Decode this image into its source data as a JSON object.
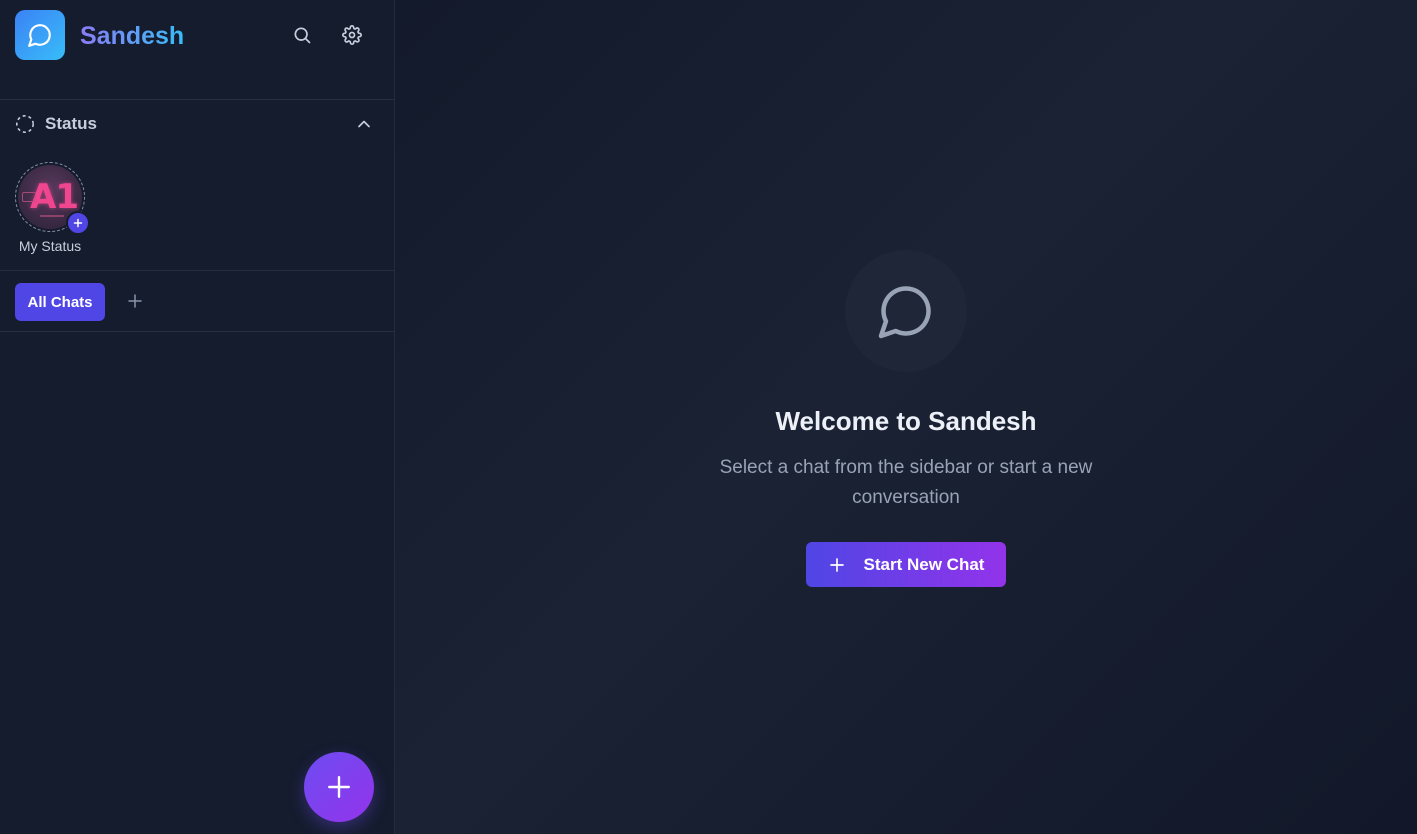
{
  "app": {
    "name": "Sandesh"
  },
  "header": {
    "search_icon": "search-icon",
    "settings_icon": "gear-icon"
  },
  "status": {
    "title": "Status",
    "my_status_label": "My Status",
    "avatar_text": "A1"
  },
  "filters": {
    "items": [
      {
        "label": "All Chats",
        "active": true
      }
    ]
  },
  "welcome": {
    "title": "Welcome to Sandesh",
    "subtitle": "Select a chat from the sidebar or start a new conversation",
    "cta_label": "Start New Chat"
  },
  "colors": {
    "accent": "#4f46e5",
    "accent_end": "#9333ea",
    "sidebar_bg": "#151c2e",
    "main_bg": "#131a2b"
  }
}
